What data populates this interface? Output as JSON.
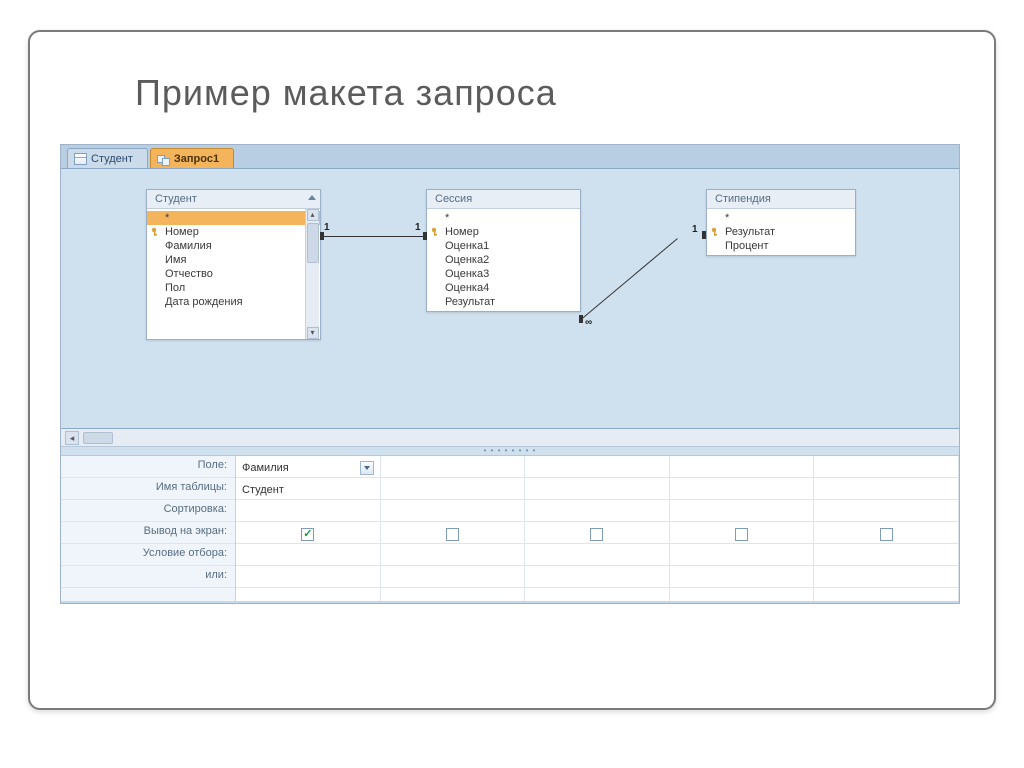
{
  "slide": {
    "title": "Пример макета запроса"
  },
  "tabs": [
    {
      "label": "Студент",
      "type": "table",
      "active": false
    },
    {
      "label": "Запрос1",
      "type": "query",
      "active": true
    }
  ],
  "entities": {
    "student": {
      "title": "Студент",
      "fields": [
        "*",
        "Номер",
        "Фамилия",
        "Имя",
        "Отчество",
        "Пол",
        "Дата рождения"
      ],
      "key_indices": [
        1
      ],
      "selected_index": 0,
      "has_scrollbar": true
    },
    "session": {
      "title": "Сессия",
      "fields": [
        "*",
        "Номер",
        "Оценка1",
        "Оценка2",
        "Оценка3",
        "Оценка4",
        "Результат"
      ],
      "key_indices": [
        1
      ],
      "has_scrollbar": false
    },
    "stipend": {
      "title": "Стипендия",
      "fields": [
        "*",
        "Результат",
        "Процент"
      ],
      "key_indices": [
        1
      ],
      "has_scrollbar": false
    }
  },
  "relationships": [
    {
      "from": "student.Номер",
      "to": "session.Номер",
      "left_card": "1",
      "right_card": "1"
    },
    {
      "from": "session.Результат",
      "to": "stipend.Результат",
      "left_card": "∞",
      "right_card": "1"
    }
  ],
  "grid": {
    "row_labels": [
      "Поле:",
      "Имя таблицы:",
      "Сортировка:",
      "Вывод на экран:",
      "Условие отбора:",
      "или:"
    ],
    "columns": [
      {
        "field": "Фамилия",
        "table": "Студент",
        "sort": "",
        "show": true,
        "criteria": "",
        "or": "",
        "field_dropdown": true
      },
      {
        "field": "",
        "table": "",
        "sort": "",
        "show": false,
        "criteria": "",
        "or": ""
      },
      {
        "field": "",
        "table": "",
        "sort": "",
        "show": false,
        "criteria": "",
        "or": ""
      },
      {
        "field": "",
        "table": "",
        "sort": "",
        "show": false,
        "criteria": "",
        "or": ""
      },
      {
        "field": "",
        "table": "",
        "sort": "",
        "show": false,
        "criteria": "",
        "or": ""
      }
    ]
  }
}
